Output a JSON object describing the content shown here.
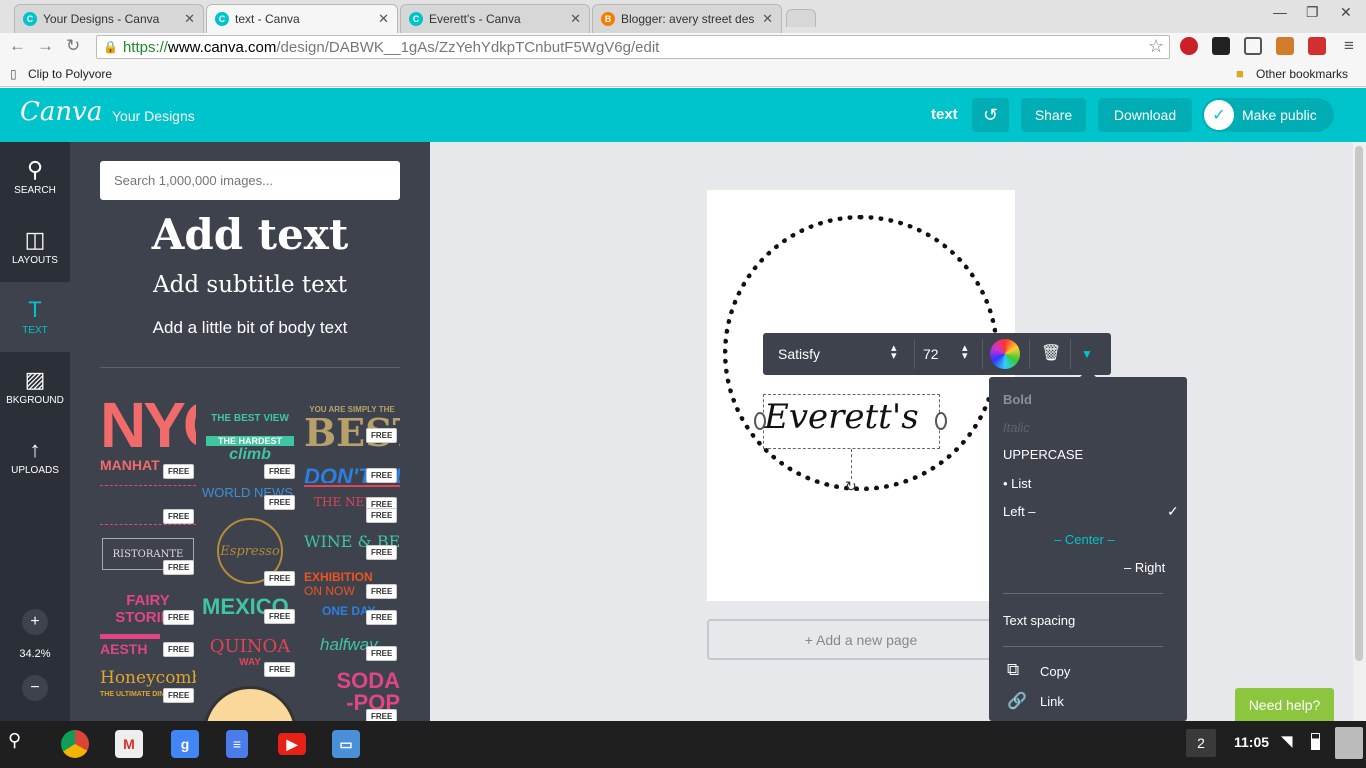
{
  "browser": {
    "tabs": [
      {
        "title": "Your Designs - Canva",
        "fav": "C",
        "color": "#00c4cc",
        "active": false
      },
      {
        "title": "text - Canva",
        "fav": "C",
        "color": "#00c4cc",
        "active": true
      },
      {
        "title": "Everett's - Canva",
        "fav": "C",
        "color": "#00c4cc",
        "active": false
      },
      {
        "title": "Blogger: avery street des",
        "fav": "B",
        "color": "#f57d00",
        "active": false
      }
    ],
    "url_scheme": "https://",
    "url_host": "www.canva.com",
    "url_path": "/design/DABWK__1gAs/ZzYehYdkpTCnbutF5WgV6g/edit",
    "bookmark_bar": {
      "left": "Clip to Polyvore",
      "right": "Other bookmarks"
    }
  },
  "header": {
    "logo": "Canva",
    "your_designs": "Your Designs",
    "doc_title": "text",
    "undo": "↺",
    "share": "Share",
    "download": "Download",
    "make_public": "Make public"
  },
  "rail": {
    "items": [
      {
        "label": "SEARCH",
        "icon": "🔍"
      },
      {
        "label": "LAYOUTS",
        "icon": "◫"
      },
      {
        "label": "TEXT",
        "icon": "T"
      },
      {
        "label": "BKGROUND",
        "icon": "▨"
      },
      {
        "label": "UPLOADS",
        "icon": "↑"
      }
    ],
    "zoom": "34.2%"
  },
  "panel": {
    "search_placeholder": "Search 1,000,000 images...",
    "add_text": "Add text",
    "add_subtitle": "Add subtitle text",
    "add_body": "Add a little bit of body text",
    "free_label": "FREE"
  },
  "canvas": {
    "text": "Everett's",
    "add_page": "+ Add a new page"
  },
  "text_toolbar": {
    "font": "Satisfy",
    "size": "72"
  },
  "format_menu": {
    "bold": "Bold",
    "italic": "Italic",
    "uppercase": "UPPERCASE",
    "list": "• List",
    "left": "Left –",
    "center": "– Center –",
    "right": "– Right",
    "check": "✓",
    "text_spacing": "Text spacing",
    "copy": "Copy",
    "link": "Link"
  },
  "help": "Need help?",
  "shelf": {
    "notification_count": "2",
    "time": "11:05"
  },
  "colors": {
    "accent": "#00c4cc",
    "panel": "#3d424d",
    "rail": "#2b2f38",
    "help": "#8cc63f"
  }
}
